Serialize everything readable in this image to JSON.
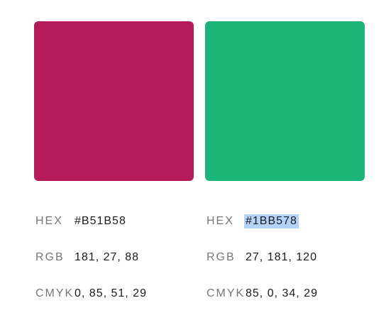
{
  "colors": [
    {
      "swatch": "#B51B58",
      "hex_label": "HEX",
      "hex": "#B51B58",
      "rgb_label": "RGB",
      "rgb": "181, 27, 88",
      "cmyk_label": "CMYK",
      "cmyk": "0, 85, 51, 29"
    },
    {
      "swatch": "#1BB578",
      "hex_label": "HEX",
      "hex": "#1BB578",
      "hex_selected": true,
      "rgb_label": "RGB",
      "rgb": "27, 181, 120",
      "cmyk_label": "CMYK",
      "cmyk": "85, 0, 34, 29"
    }
  ],
  "selection_color": "#B3D3FB"
}
